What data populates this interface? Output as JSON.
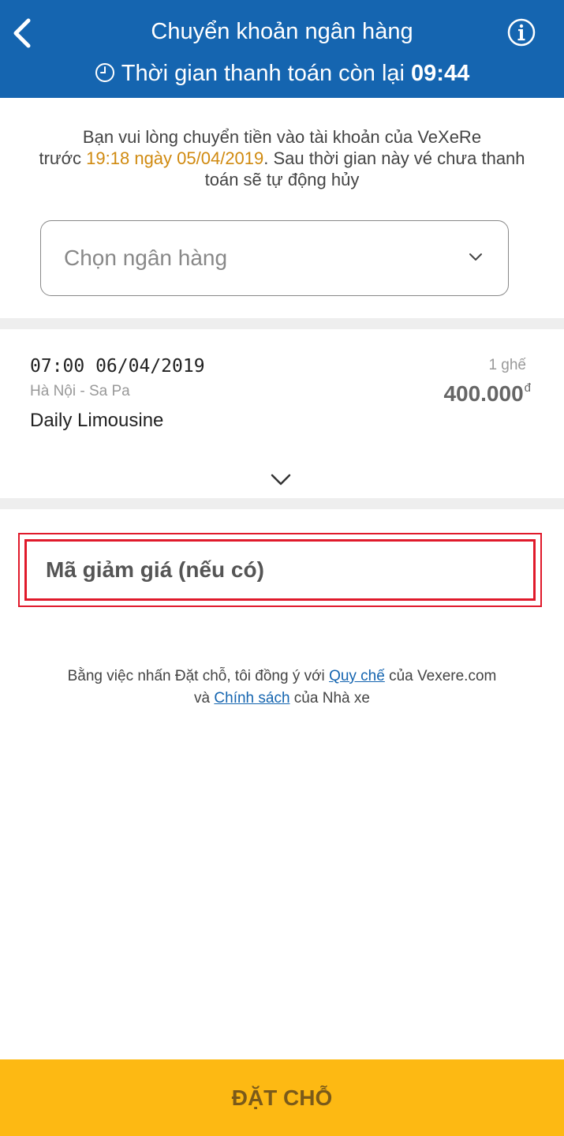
{
  "header": {
    "title": "Chuyển khoản ngân hàng",
    "timer_label": "Thời gian thanh toán còn lại",
    "timer_value": "09:44"
  },
  "notice": {
    "line1": "Bạn vui lòng chuyển tiền vào tài khoản của VeXeRe",
    "before": "trước ",
    "deadline": "19:18 ngày 05/04/2019",
    "after": ". Sau thời gian này vé chưa thanh toán sẽ tự động hủy"
  },
  "bank_select": {
    "placeholder": "Chọn ngân hàng"
  },
  "trip": {
    "datetime": "07:00 06/04/2019",
    "route": "Hà Nội - Sa Pa",
    "company": "Daily Limousine",
    "seats": "1 ghế",
    "price": "400.000",
    "currency": "đ"
  },
  "discount": {
    "placeholder": "Mã giảm giá (nếu có)"
  },
  "terms": {
    "prefix": "Bằng việc nhấn Đặt chỗ, tôi đồng ý với ",
    "link1": "Quy chế",
    "middle": " của Vexere.com",
    "line2_prefix": "và ",
    "link2": "Chính sách",
    "suffix": " của Nhà xe"
  },
  "submit": {
    "label": "ĐẶT CHỖ"
  },
  "colors": {
    "header": "#1565b0",
    "deadline": "#d08a10",
    "submit": "#fdb913",
    "highlight": "#e01a2b"
  }
}
